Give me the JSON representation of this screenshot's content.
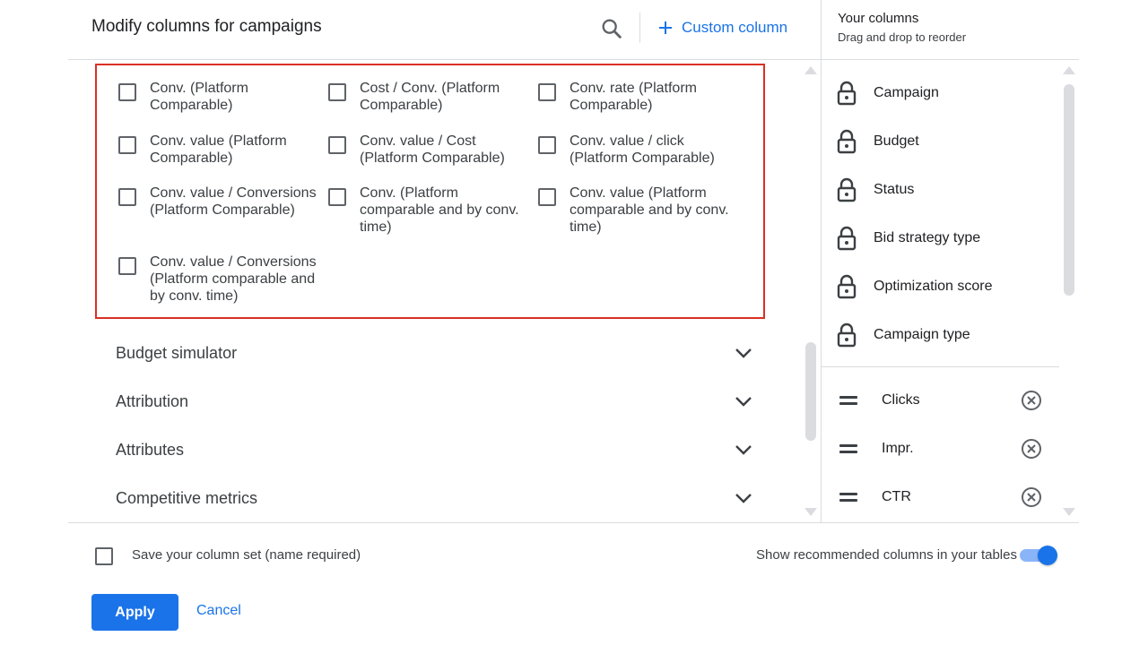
{
  "header": {
    "title": "Modify columns for campaigns",
    "search_icon": "search-icon",
    "custom_column_label": "Custom column",
    "accent": "#1a73e8"
  },
  "options": [
    "Conv. (Platform Comparable)",
    "Cost / Conv. (Platform Comparable)",
    "Conv. rate (Platform Comparable)",
    "Conv. value (Platform Comparable)",
    "Conv. value / Cost (Platform Comparable)",
    "Conv. value / click (Platform Comparable)",
    "Conv. value / Conversions (Platform Comparable)",
    "Conv. (Platform comparable and by conv. time)",
    "Conv. value (Platform comparable and by conv. time)",
    "Conv. value / Conversions (Platform comparable and by conv. time)"
  ],
  "sections": [
    "Budget simulator",
    "Attribution",
    "Attributes",
    "Competitive metrics"
  ],
  "right_panel": {
    "title": "Your columns",
    "subtitle": "Drag and drop to reorder",
    "locked": [
      "Campaign",
      "Budget",
      "Status",
      "Bid strategy type",
      "Optimization score",
      "Campaign type"
    ],
    "movable": [
      "Clicks",
      "Impr.",
      "CTR"
    ]
  },
  "footer": {
    "save_label": "Save your column set (name required)",
    "recommended_label": "Show recommended columns in your tables",
    "recommended_on": true,
    "apply_label": "Apply",
    "cancel_label": "Cancel"
  },
  "colors": {
    "highlight_border": "#d93025",
    "toggle_on": "#1a73e8"
  }
}
